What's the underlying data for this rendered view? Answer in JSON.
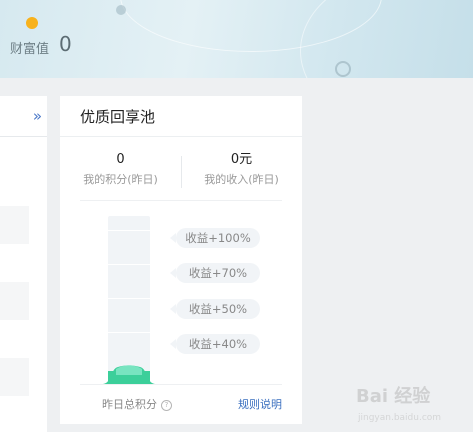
{
  "banner": {
    "wealth_label": "财富值",
    "wealth_value": "0",
    "accent_dot_color": "#f8b21c"
  },
  "left_panel": {
    "expand_icon": "»"
  },
  "pool": {
    "title": "优质回享池",
    "stats": [
      {
        "value": "0",
        "label": "我的积分(昨日)"
      },
      {
        "value": "0元",
        "label": "我的收入(昨日)"
      }
    ],
    "fill_level_percent": 8,
    "fill_color": "#3ccf9a",
    "tiers": [
      {
        "label": "收益+100%"
      },
      {
        "label": "收益+70%"
      },
      {
        "label": "收益+50%"
      },
      {
        "label": "收益+40%"
      }
    ],
    "footer_left": "昨日总积分",
    "footer_right": "规则说明",
    "help_icon": "?"
  },
  "watermark": {
    "text": "Bai 经验",
    "sub": "jingyan.baidu.com"
  }
}
